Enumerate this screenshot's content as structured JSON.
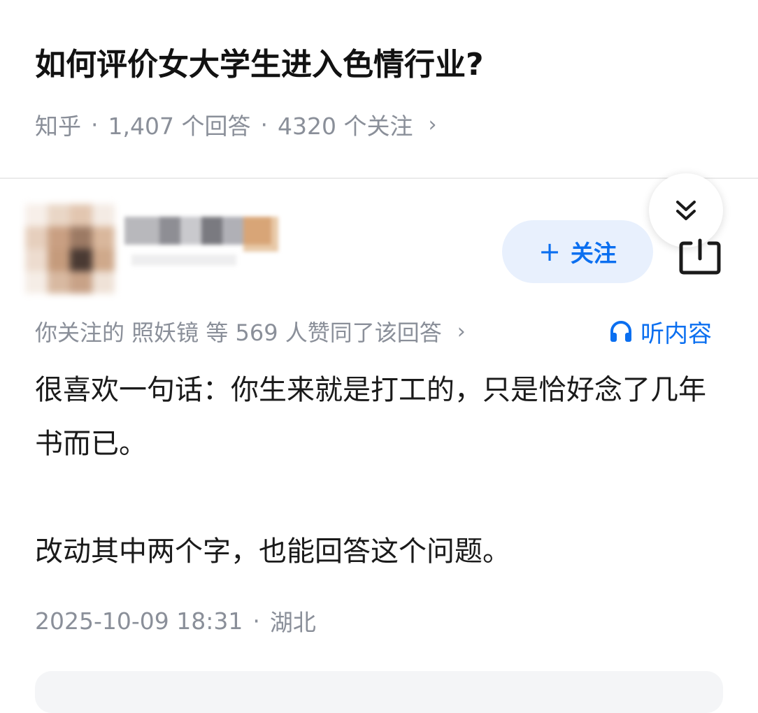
{
  "question": {
    "title": "如何评价女大学生进入色情行业?",
    "source": "知乎",
    "separator": "·",
    "answers_count": "1,407 个回答",
    "followers_count": "4320 个关注",
    "chevron": "›"
  },
  "author": {
    "avatar_state": "pixelated",
    "name_state": "pixelated",
    "follow_button_label": "关注",
    "follow_button_icon": "+"
  },
  "collapse_button": {
    "icon": "double-chevron-down-icon"
  },
  "share_button": {
    "icon": "share-icon"
  },
  "upvote_line": {
    "text": "你关注的 照妖镜 等 569 人赞同了该回答",
    "chevron": "›"
  },
  "listen_button": {
    "label": "听内容",
    "icon": "headphones-icon"
  },
  "answer": {
    "paragraph_1": "很喜欢一句话：你生来就是打工的，只是恰好念了几年书而已。",
    "paragraph_2": "改动其中两个字，也能回答这个问题。"
  },
  "footer": {
    "datetime": "2025-10-09 18:31",
    "separator": "·",
    "location": "湖北"
  },
  "colors": {
    "accent": "#0b6ff0",
    "follow_bg": "#e8f0fd",
    "meta_text": "#8a8f99",
    "body_text": "#1a1a1a"
  }
}
